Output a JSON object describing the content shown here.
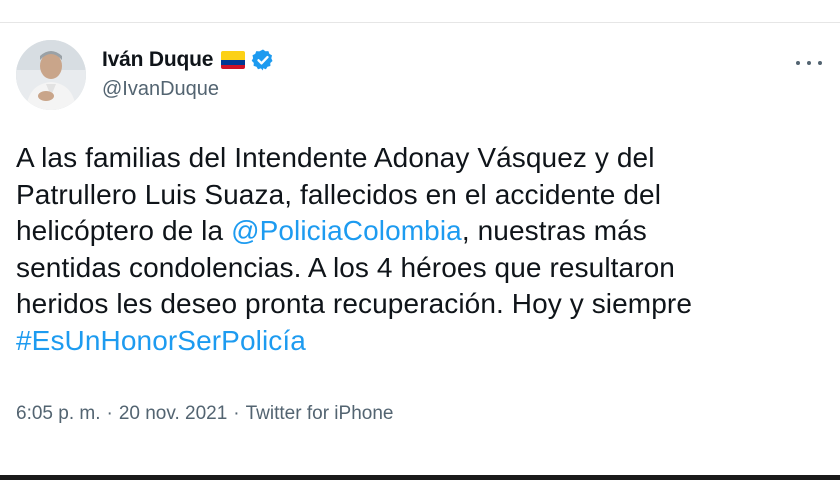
{
  "author": {
    "display_name": "Iván Duque",
    "handle": "@IvanDuque",
    "flag": "colombia-flag-icon",
    "verified": true
  },
  "tweet": {
    "line1": "A las familias del Intendente Adonay Vásquez y del",
    "line2": "Patrullero Luis Suaza, fallecidos en el accidente del",
    "line3_pre": "helicóptero de la ",
    "mention": "@PoliciaColombia",
    "line3_post": ", nuestras más",
    "line4": "sentidas condolencias. A los 4 héroes que resultaron",
    "line5": "heridos les deseo pronta recuperación. Hoy y siempre",
    "hashtag": "#EsUnHonorSerPolicía"
  },
  "meta": {
    "time": "6:05 p. m.",
    "separator": "·",
    "date": "20 nov. 2021",
    "source": "Twitter for iPhone"
  },
  "colors": {
    "link": "#1d9bf0",
    "secondary_text": "#536471",
    "verified": "#1d9bf0"
  }
}
